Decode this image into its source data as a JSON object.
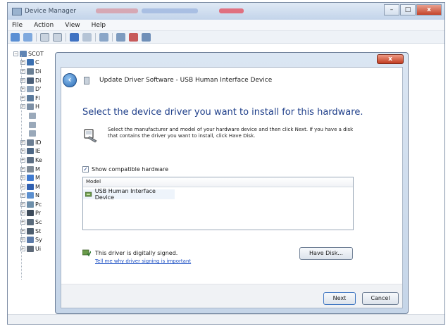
{
  "device_manager": {
    "title": "Device Manager",
    "menu": [
      "File",
      "Action",
      "View",
      "Help"
    ],
    "tree": {
      "root_label": "SCOT",
      "items": [
        {
          "label": "C",
          "color": "#3a6fb0"
        },
        {
          "label": "Di",
          "color": "#6a7f94"
        },
        {
          "label": "Di",
          "color": "#4b5f78"
        },
        {
          "label": "D'",
          "color": "#8aa0b8"
        },
        {
          "label": "Fl",
          "color": "#5a7a9c"
        },
        {
          "label": "H",
          "color": "#7c8fa5"
        },
        {
          "label": "",
          "color": "#9aa9ba"
        },
        {
          "label": "",
          "color": "#9aa9ba"
        },
        {
          "label": "",
          "color": "#9aa9ba"
        },
        {
          "label": "ID",
          "color": "#6b7e93"
        },
        {
          "label": "IE",
          "color": "#4d6785"
        },
        {
          "label": "Ke",
          "color": "#5d6f84"
        },
        {
          "label": "M",
          "color": "#7e8a96"
        },
        {
          "label": "M",
          "color": "#3f7ad0"
        },
        {
          "label": "M",
          "color": "#2f5fb0"
        },
        {
          "label": "N",
          "color": "#5b8fcf"
        },
        {
          "label": "Pc",
          "color": "#6e8faa"
        },
        {
          "label": "Pr",
          "color": "#3c4a5a"
        },
        {
          "label": "Sc",
          "color": "#5a6b7c"
        },
        {
          "label": "St",
          "color": "#4d5d6e"
        },
        {
          "label": "Sy",
          "color": "#5b7aa8"
        },
        {
          "label": "Ui",
          "color": "#5d6978"
        }
      ]
    }
  },
  "dialog": {
    "close_label": "x",
    "title": "Update Driver Software - USB Human Interface Device",
    "heading": "Select the device driver you want to install for this hardware.",
    "instruction": "Select the manufacturer and model of your hardware device and then click Next. If you have a disk that contains the driver you want to install, click Have Disk.",
    "show_compatible": {
      "label": "Show compatible hardware",
      "checked": true,
      "mark": "✓"
    },
    "model_list": {
      "header": "Model",
      "items": [
        "USB Human Interface Device"
      ]
    },
    "signed_text": "This driver is digitally signed.",
    "signed_link": "Tell me why driver signing is important",
    "have_disk_label": "Have Disk...",
    "next_label": "Next",
    "cancel_label": "Cancel"
  },
  "colors": {
    "heading_blue": "#1f3f8a",
    "link_blue": "#1c4fc4",
    "close_red": "#c23d22"
  }
}
